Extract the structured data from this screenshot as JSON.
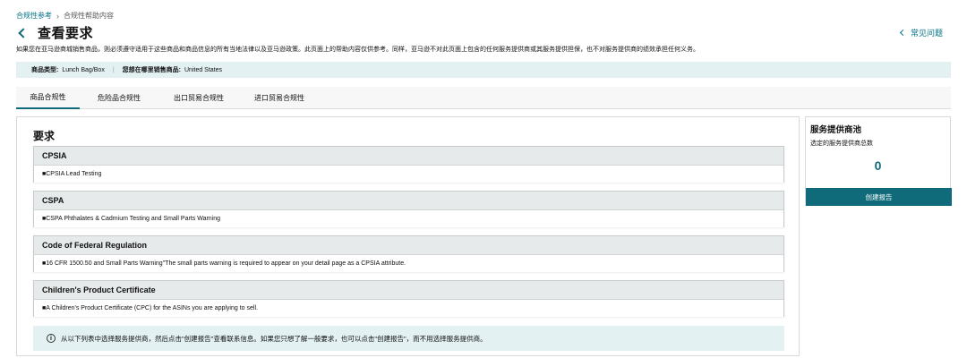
{
  "breadcrumb": {
    "root": "合规性参考",
    "separator": "›",
    "current": "合规性帮助内容"
  },
  "header": {
    "title": "查看要求",
    "faq_label": "常见问题"
  },
  "disclaimer": "如果您在亚马逊商城销售商品，则必须遵守适用于这些商品和商品信息的所有当地法律以及亚马逊政策。此页面上的帮助内容仅供参考。同样，亚马逊不对此页面上包含的任何服务提供商或其服务提供担保，也不对服务提供商的绩效承担任何义务。",
  "product_bar": {
    "type_label": "商品类型:",
    "type_value": "Lunch Bag/Box",
    "market_label": "您想在哪里销售商品:",
    "market_value": "United States"
  },
  "tabs": [
    {
      "label": "商品合规性",
      "active": true
    },
    {
      "label": "危险品合规性",
      "active": false
    },
    {
      "label": "出口贸易合规性",
      "active": false
    },
    {
      "label": "进口贸易合规性",
      "active": false
    }
  ],
  "requirements": {
    "title": "要求",
    "items": [
      {
        "heading": "CPSIA",
        "detail": "■CPSIA Lead Testing"
      },
      {
        "heading": "CSPA",
        "detail": "■CSPA Phthalates & Cadmium Testing and Small Parts Warning"
      },
      {
        "heading": "Code of Federal Regulation",
        "detail": "■16 CFR 1500.50 and Small Parts Warning\"The small parts warning is required to appear on your detail page as a CPSIA attribute."
      },
      {
        "heading": "Children's Product Certificate",
        "detail": "■A Children's Product Certificate (CPC) for the ASINs you are applying to sell."
      }
    ],
    "info_icon": "info-icon",
    "info_text": "从以下列表中选择服务提供商，然后点击\"创建报告\"查看联系信息。如果您只想了解一般要求，也可以点击\"创建报告\"，而不用选择服务提供商。"
  },
  "provider_pool": {
    "title": "服务提供商池",
    "subtitle": "选定的服务提供商总数",
    "count": "0",
    "button_label": "创建报告"
  },
  "colors": {
    "accent": "#0f6b7a",
    "link": "#007185",
    "info_bg": "#e3f1f3",
    "section_head_bg": "#e6eaea"
  }
}
